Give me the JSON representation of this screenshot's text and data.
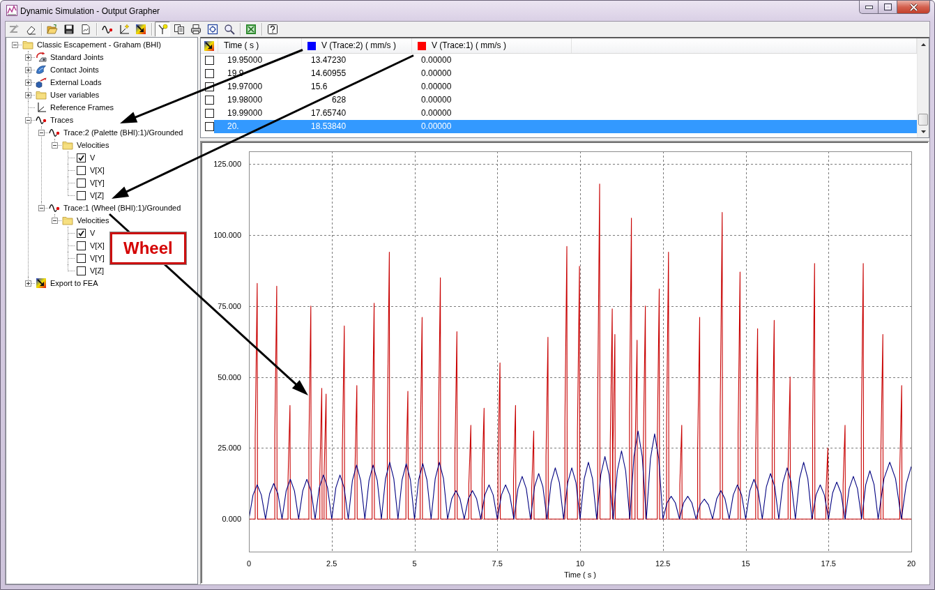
{
  "window": {
    "title": "Dynamic Simulation - Output Grapher"
  },
  "toolbar": [
    [
      {
        "disabled": true,
        "pressed": false
      },
      {
        "disabled": false,
        "pressed": false
      }
    ],
    [
      {
        "disabled": false,
        "pressed": false
      },
      {
        "disabled": false,
        "pressed": false
      },
      {
        "disabled": false,
        "pressed": false
      }
    ],
    [
      {
        "disabled": false,
        "pressed": false
      },
      {
        "disabled": false,
        "pressed": false
      },
      {
        "disabled": false,
        "pressed": false
      }
    ],
    [
      {
        "disabled": false,
        "pressed": true
      },
      {
        "disabled": false,
        "pressed": false
      },
      {
        "disabled": false,
        "pressed": false
      },
      {
        "disabled": false,
        "pressed": false
      },
      {
        "disabled": false,
        "pressed": false
      }
    ],
    [
      {
        "disabled": false,
        "pressed": false
      }
    ],
    [
      {
        "disabled": false,
        "pressed": false
      }
    ]
  ],
  "tree": [
    {
      "label": "Classic Escapement - Graham (BHI)",
      "kind": "folder",
      "expanded": true,
      "children": [
        {
          "label": "Standard Joints",
          "kind": "joints",
          "expanded": false
        },
        {
          "label": "Contact Joints",
          "kind": "contact",
          "expanded": false
        },
        {
          "label": "External Loads",
          "kind": "loads",
          "expanded": false
        },
        {
          "label": "User variables",
          "kind": "folder",
          "expanded": false
        },
        {
          "label": "Reference Frames",
          "kind": "frames"
        },
        {
          "label": "Traces",
          "kind": "trace",
          "expanded": true,
          "children": [
            {
              "label": "Trace:2 (Palette (BHI):1)/Grounded",
              "kind": "trace",
              "expanded": true,
              "children": [
                {
                  "label": "Velocities",
                  "kind": "folder",
                  "expanded": true,
                  "children": [
                    {
                      "label": "V",
                      "kind": "check",
                      "checked": true
                    },
                    {
                      "label": "V[X]",
                      "kind": "check",
                      "checked": false
                    },
                    {
                      "label": "V[Y]",
                      "kind": "check",
                      "checked": false
                    },
                    {
                      "label": "V[Z]",
                      "kind": "check",
                      "checked": false
                    }
                  ]
                }
              ]
            },
            {
              "label": "Trace:1 (Wheel (BHI):1)/Grounded",
              "kind": "trace",
              "expanded": true,
              "children": [
                {
                  "label": "Velocities",
                  "kind": "folder",
                  "expanded": true,
                  "children": [
                    {
                      "label": "V",
                      "kind": "check",
                      "checked": true
                    },
                    {
                      "label": "V[X]",
                      "kind": "check",
                      "checked": false
                    },
                    {
                      "label": "V[Y]",
                      "kind": "check",
                      "checked": false
                    },
                    {
                      "label": "V[Z]",
                      "kind": "check",
                      "checked": false
                    }
                  ]
                }
              ]
            }
          ]
        },
        {
          "label": "Export to FEA",
          "kind": "fea",
          "expanded": false
        }
      ]
    }
  ],
  "table": {
    "columns": [
      {
        "label": "Time ( s )"
      },
      {
        "label": "V (Trace:2) ( mm/s )",
        "color": "#0000ff"
      },
      {
        "label": "V (Trace:1) ( mm/s )",
        "color": "#ff0000"
      }
    ],
    "rows": [
      {
        "checked": false,
        "selected": false,
        "cells": [
          "19.95000",
          "13.47230",
          "0.00000"
        ]
      },
      {
        "checked": false,
        "selected": false,
        "cells": [
          "19.9",
          "14.60955",
          "0.00000"
        ]
      },
      {
        "checked": false,
        "selected": false,
        "cells": [
          "19.97000",
          "15.6",
          "0.00000"
        ]
      },
      {
        "checked": false,
        "selected": false,
        "cells": [
          "19.98000",
          {
            "text": "628",
            "start_hidden": true
          },
          "0.00000"
        ]
      },
      {
        "checked": false,
        "selected": false,
        "cells": [
          "19.99000",
          "17.65740",
          "0.00000"
        ]
      },
      {
        "checked": false,
        "selected": true,
        "cells": [
          "20.",
          "18.53840",
          "0.00000"
        ]
      }
    ]
  },
  "graph": {
    "chart_data": [
      {
        "type": "line",
        "xlabel": "Time ( s )",
        "xlim": [
          0,
          20
        ],
        "ylim": [
          -11.5,
          129.5
        ],
        "xticks": [
          0,
          2.5,
          5,
          7.5,
          10,
          12.5,
          15,
          17.5,
          20
        ],
        "yticks": [
          {
            "value": 0,
            "label": "0.000"
          },
          {
            "value": 25,
            "label": "25.000"
          },
          {
            "value": 50,
            "label": "50.000"
          },
          {
            "value": 75,
            "label": "75.000"
          },
          {
            "value": 100,
            "label": "100.000"
          },
          {
            "value": 125,
            "label": "125.000"
          }
        ],
        "grid": true,
        "series": [
          {
            "color": "#c80000",
            "x": [
              0,
              0.19,
              0.19,
              0.25,
              0.26,
              0.78,
              0.78,
              0.84,
              0.85,
              1.18,
              1.18,
              1.24,
              1.25,
              1.81,
              1.81,
              1.87,
              1.88,
              2.14,
              2.14,
              2.2,
              2.21,
              2.27,
              2.27,
              2.33,
              2.34,
              2.82,
              2.82,
              2.88,
              2.89,
              3.2,
              3.2,
              3.26,
              3.27,
              3.72,
              3.72,
              3.78,
              3.79,
              4.18,
              4.18,
              4.24,
              4.25,
              4.74,
              4.74,
              4.8,
              4.81,
              5.17,
              5.17,
              5.23,
              5.24,
              5.72,
              5.72,
              5.78,
              5.79,
              6.22,
              6.22,
              6.28,
              6.29,
              6.64,
              6.64,
              6.7,
              6.71,
              7.04,
              7.04,
              7.1,
              7.11,
              7.52,
              7.52,
              7.58,
              7.59,
              7.99,
              7.99,
              8.05,
              8.06,
              8.54,
              8.54,
              8.6,
              8.61,
              8.97,
              8.97,
              9.03,
              9.04,
              9.54,
              9.54,
              9.6,
              9.61,
              9.92,
              9.92,
              9.98,
              9.99,
              10.53,
              10.53,
              10.59,
              10.6,
              10.91,
              10.91,
              10.97,
              10.98,
              10.99,
              10.99,
              11.05,
              11.06,
              11.49,
              11.49,
              11.55,
              11.56,
              11.66,
              11.66,
              11.72,
              11.73,
              11.91,
              11.91,
              11.97,
              11.98,
              12.33,
              12.33,
              12.39,
              12.4,
              12.61,
              12.61,
              12.67,
              12.68,
              13.01,
              13.01,
              13.07,
              13.08,
              13.55,
              13.55,
              13.61,
              13.62,
              14.23,
              14.23,
              14.29,
              14.3,
              14.77,
              14.77,
              14.83,
              14.84,
              15.3,
              15.3,
              15.36,
              15.37,
              15.8,
              15.8,
              15.86,
              15.87,
              16.28,
              16.28,
              16.34,
              16.35,
              17.02,
              17.02,
              17.08,
              17.09,
              17.42,
              17.42,
              17.48,
              17.49,
              17.94,
              17.94,
              18,
              18.01,
              18.49,
              18.49,
              18.55,
              18.56,
              19.08,
              19.08,
              19.14,
              19.15,
              19.65,
              19.65,
              19.71,
              19.72,
              20
            ],
            "values": [
              0,
              0,
              29,
              83,
              0,
              0,
              29,
              82,
              0,
              0,
              14,
              40,
              0,
              0,
              26,
              75,
              0,
              0,
              16,
              46,
              0,
              0,
              15,
              44,
              0,
              0,
              24,
              68,
              0,
              0,
              16,
              47,
              0,
              0,
              27,
              76,
              0,
              0,
              33,
              94,
              0,
              0,
              16,
              45,
              0,
              0,
              25,
              71,
              0,
              0,
              30,
              85,
              0,
              0,
              23,
              66,
              0,
              0,
              12,
              33,
              0,
              0,
              14,
              39,
              0,
              0,
              19,
              55,
              0,
              0,
              14,
              40,
              0,
              0,
              11,
              31,
              0,
              0,
              22,
              64,
              0,
              0,
              34,
              96,
              0,
              0,
              31,
              89,
              0,
              0,
              41,
              118,
              0,
              0,
              26,
              74,
              0,
              0,
              23,
              65,
              0,
              0,
              37,
              106,
              0,
              0,
              22,
              63,
              0,
              0,
              26,
              75,
              0,
              0,
              28,
              81,
              0,
              0,
              33,
              94,
              0,
              0,
              12,
              33,
              0,
              0,
              25,
              71,
              0,
              0,
              38,
              108,
              0,
              0,
              30,
              87,
              0,
              0,
              23,
              67,
              0,
              0,
              25,
              70,
              0,
              0,
              18,
              50,
              0,
              0,
              32,
              90,
              0,
              0,
              9,
              25,
              0,
              0,
              12,
              33,
              0,
              0,
              32,
              90,
              0,
              0,
              23,
              65,
              0,
              0,
              16,
              47,
              0,
              0
            ]
          },
          {
            "color": "#000080",
            "x": [
              0,
              0.125,
              0.25,
              0.375,
              0.5,
              0.625,
              0.75,
              0.875,
              1,
              1.125,
              1.25,
              1.375,
              1.5,
              1.625,
              1.75,
              1.875,
              2,
              2.125,
              2.25,
              2.375,
              2.5,
              2.625,
              2.75,
              2.875,
              3,
              3.125,
              3.25,
              3.375,
              3.5,
              3.625,
              3.75,
              3.875,
              4,
              4.125,
              4.25,
              4.375,
              4.5,
              4.625,
              4.75,
              4.875,
              5,
              5.125,
              5.25,
              5.375,
              5.5,
              5.625,
              5.75,
              5.875,
              6,
              6.125,
              6.25,
              6.375,
              6.5,
              6.625,
              6.75,
              6.875,
              7,
              7.125,
              7.25,
              7.375,
              7.5,
              7.625,
              7.75,
              7.875,
              8,
              8.125,
              8.25,
              8.375,
              8.5,
              8.625,
              8.75,
              8.875,
              9,
              9.125,
              9.25,
              9.375,
              9.5,
              9.625,
              9.75,
              9.875,
              10,
              10.125,
              10.25,
              10.375,
              10.5,
              10.625,
              10.75,
              10.875,
              11,
              11.125,
              11.25,
              11.375,
              11.5,
              11.625,
              11.75,
              11.875,
              12,
              12.125,
              12.25,
              12.375,
              12.5,
              12.625,
              12.75,
              12.875,
              13,
              13.125,
              13.25,
              13.375,
              13.5,
              13.625,
              13.75,
              13.875,
              14,
              14.125,
              14.25,
              14.375,
              14.5,
              14.625,
              14.75,
              14.875,
              15,
              15.125,
              15.25,
              15.375,
              15.5,
              15.625,
              15.75,
              15.875,
              16,
              16.125,
              16.25,
              16.375,
              16.5,
              16.625,
              16.75,
              16.875,
              17,
              17.125,
              17.25,
              17.375,
              17.5,
              17.625,
              17.75,
              17.875,
              18,
              18.125,
              18.25,
              18.375,
              18.5,
              18.625,
              18.75,
              18.875,
              19,
              19.175,
              19.35,
              19.525,
              19.7,
              19.85,
              20
            ],
            "values": [
              0,
              8.5,
              12,
              8.5,
              0,
              8.9,
              12.5,
              8.9,
              0,
              9.9,
              14,
              9.9,
              0,
              9.9,
              14,
              9.9,
              0,
              11,
              15.5,
              11,
              0,
              11,
              15.5,
              11,
              0,
              13.5,
              19,
              13.5,
              0,
              13.5,
              19,
              13.5,
              0,
              14.2,
              20,
              14.2,
              0,
              13.8,
              19.5,
              13.8,
              0,
              13.8,
              19.5,
              13.8,
              0,
              14.2,
              20,
              14.2,
              0,
              7.1,
              10,
              7.1,
              0,
              7.1,
              10,
              7.1,
              0,
              8.5,
              12,
              8.5,
              0,
              8.5,
              12,
              8.5,
              0,
              10.7,
              15,
              10.7,
              0,
              11.4,
              16,
              11.4,
              0,
              12.8,
              18,
              12.8,
              0,
              12.8,
              18,
              12.8,
              0,
              14.2,
              20,
              14.2,
              0,
              15.6,
              22,
              15.6,
              0,
              17,
              24,
              17,
              0,
              22,
              31,
              22,
              0,
              21.3,
              30,
              21.3,
              0,
              5.7,
              8,
              5.7,
              0,
              5.7,
              8,
              5.7,
              0,
              5,
              7,
              5,
              0,
              7.1,
              10,
              7.1,
              0,
              8.5,
              12,
              8.5,
              0,
              9.9,
              14,
              9.9,
              0,
              11.4,
              16,
              11.4,
              0,
              12.8,
              18,
              12.8,
              0,
              14.2,
              20,
              14.2,
              0,
              8.5,
              12,
              8.5,
              0,
              9.2,
              13,
              9.2,
              0,
              10.7,
              15,
              10.7,
              0,
              12.1,
              17,
              12.1,
              0,
              14.2,
              20,
              14.2,
              0,
              12.5,
              18.5
            ]
          }
        ]
      }
    ]
  },
  "callout": {
    "text": "Wheel"
  }
}
